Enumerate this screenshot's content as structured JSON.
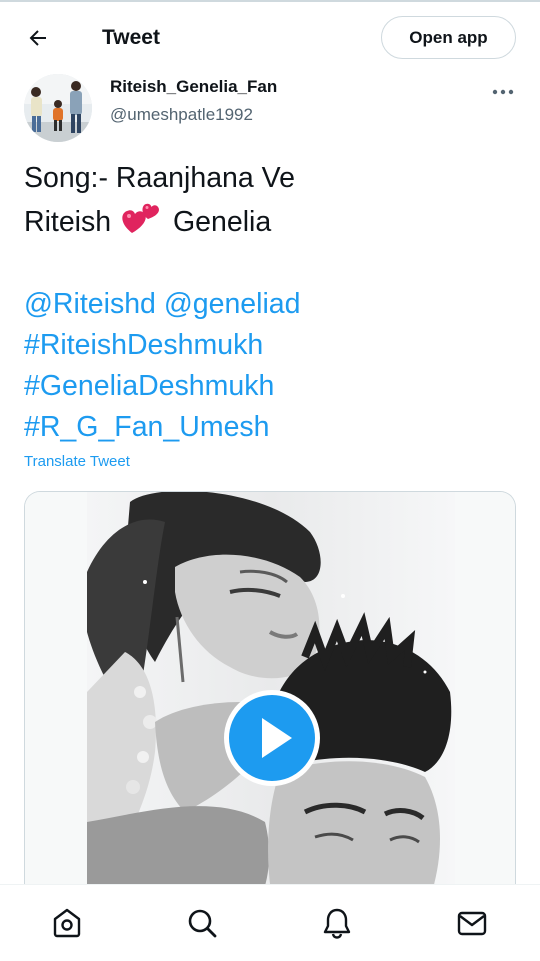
{
  "header": {
    "title": "Tweet",
    "open_app_label": "Open app"
  },
  "icons": {
    "back": "arrow-left-icon",
    "more": "more-horizontal-icon",
    "play": "play-icon",
    "home": "home-icon",
    "search": "search-icon",
    "notifications": "bell-icon",
    "messages": "envelope-icon"
  },
  "author": {
    "name": "Riteish_Genelia_Fan",
    "handle": "@umeshpatle1992"
  },
  "tweet": {
    "line1": "Song:- Raanjhana Ve",
    "line2_a": "Riteish",
    "emoji": "💞",
    "line2_b": "Genelia",
    "mentions": "@Riteishd @geneliad",
    "hashtags": [
      "#RiteishDeshmukh",
      "#GeneliaDeshmukh",
      "#R_G_Fan_Umesh"
    ],
    "translate_label": "Translate Tweet"
  },
  "colors": {
    "accent": "#1d9bf0",
    "text": "#0f1419",
    "secondary_text": "#536471",
    "border": "#cfd9de"
  }
}
